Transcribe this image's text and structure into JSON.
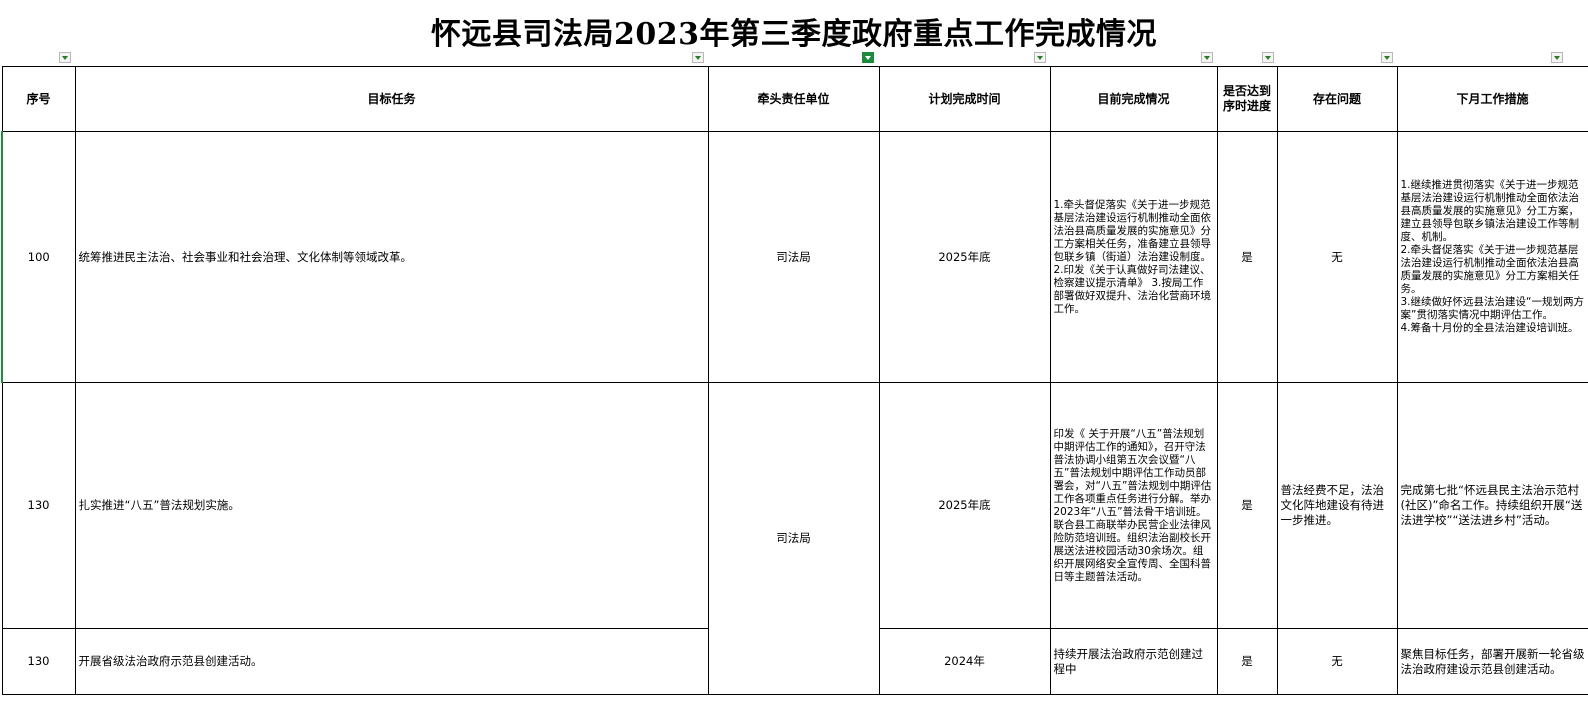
{
  "title": "怀远县司法局2023年第三季度政府重点工作完成情况",
  "headers": {
    "seq": "序号",
    "task": "目标任务",
    "unit": "牵头责任单位",
    "time": "计划完成时间",
    "status": "目前完成情况",
    "progress": "是否达到序时进度",
    "problem": "存在问题",
    "next": "下月工作措施"
  },
  "rows": [
    {
      "seq": "100",
      "task": "统筹推进民主法治、社会事业和社会治理、文化体制等领域改革。",
      "unit": "司法局",
      "time": "2025年底",
      "status": "1.牵头督促落实《关于进一步规范基层法治建设运行机制推动全面依法治县高质量发展的实施意见》分工方案相关任务，准备建立县领导包联乡镇（街道）法治建设制度。2.印发《关于认真做好司法建议、检察建议提示清单》 3.按局工作部署做好双提升、法治化营商环境工作。",
      "progress": "是",
      "problem": "无",
      "next": "1.继续推进贯彻落实《关于进一步规范基层法治建设运行机制推动全面依法治县高质量发展的实施意见》分工方案，建立县领导包联乡镇法治建设工作等制度、机制。\n2.牵头督促落实《关于进一步规范基层法治建设运行机制推动全面依法治县高质量发展的实施意见》分工方案相关任务。\n3.继续做好怀远县法治建设“一规划两方案”贯彻落实情况中期评估工作。\n4.筹备十月份的全县法治建设培训班。"
    },
    {
      "seq": "130",
      "task": "扎实推进“八五”普法规划实施。",
      "unit": "司法局",
      "time": "2025年底",
      "status": "印发《 关于开展“八五”普法规划中期评估工作的通知》，召开守法普法协调小组第五次会议暨“八五”普法规划中期评估工作动员部署会，对“八五”普法规划中期评估工作各项重点任务进行分解。举办2023年“八五”普法骨干培训班。联合县工商联举办民营企业法律风险防范培训班。组织法治副校长开展送法进校园活动30余场次。组织开展网络安全宣传周、全国科普日等主题普法活动。",
      "progress": "是",
      "problem": "普法经费不足，法治文化阵地建设有待进一步推进。",
      "next": "完成第七批“怀远县民主法治示范村(社区)”命名工作。持续组织开展“送法进学校”“送法进乡村”活动。"
    },
    {
      "seq": "130",
      "task": "开展省级法治政府示范县创建活动。",
      "time": "2024年",
      "status": "持续开展法治政府示范创建过程中",
      "progress": "是",
      "problem": "无",
      "next": "聚焦目标任务，部署开展新一轮省级法治政府建设示范县创建活动。"
    }
  ]
}
